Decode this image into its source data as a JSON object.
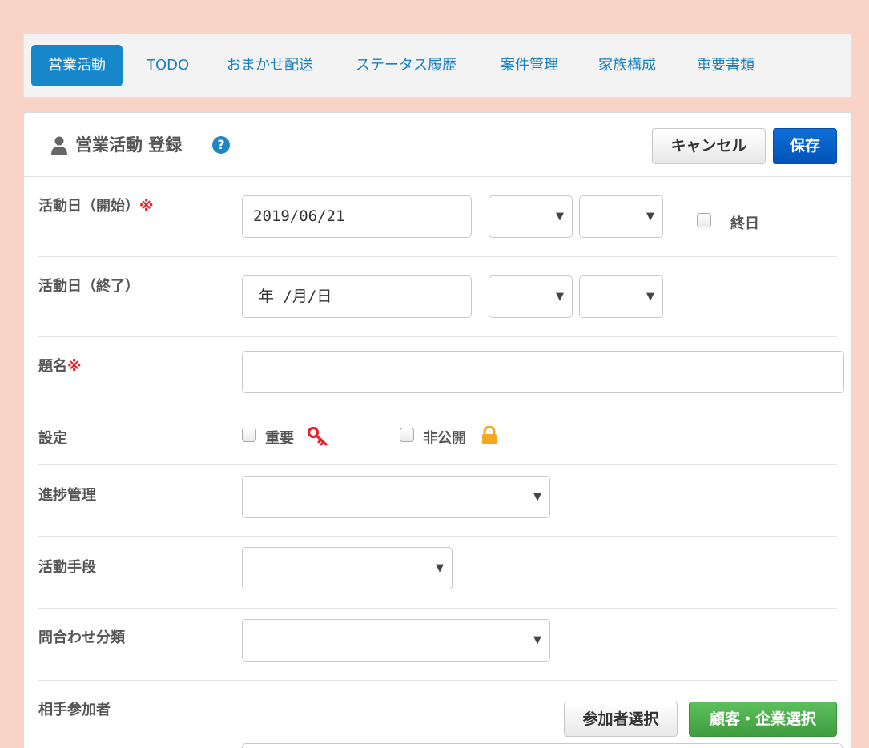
{
  "tabs": [
    {
      "label": "営業活動"
    },
    {
      "label": "TODO"
    },
    {
      "label": "おまかせ配送"
    },
    {
      "label": "ステータス履歴"
    },
    {
      "label": "案件管理"
    },
    {
      "label": "家族構成"
    },
    {
      "label": "重要書類"
    }
  ],
  "header": {
    "title": "営業活動 登録",
    "help_icon": "?",
    "cancel_label": "キャンセル",
    "save_label": "保存"
  },
  "form": {
    "start_date": {
      "label": "活動日（開始）",
      "required_mark": "※",
      "value": "2019/06/21",
      "allday_label": "終日"
    },
    "end_date": {
      "label": "活動日（終了）",
      "placeholder": "年 /月/日"
    },
    "subject": {
      "label": "題名",
      "required_mark": "※",
      "value": ""
    },
    "settings": {
      "label": "設定",
      "important_label": "重要",
      "private_label": "非公開"
    },
    "progress": {
      "label": "進捗管理"
    },
    "method": {
      "label": "活動手段"
    },
    "inquiry": {
      "label": "問合わせ分類"
    },
    "participants": {
      "label": "相手参加者",
      "select_participant_label": "参加者選択",
      "select_customer_label": "顧客・企業選択"
    }
  },
  "icons": {
    "select_arrow": "▼"
  },
  "colors": {
    "accent": "#1787cc",
    "primary": "#0153b8",
    "success": "#47a847",
    "required": "#e8212a",
    "key_icon": "#e8212a",
    "lock_icon": "#f5a623"
  }
}
